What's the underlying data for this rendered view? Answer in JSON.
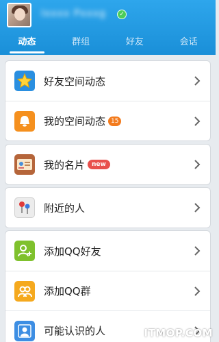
{
  "profile": {
    "nickname": "Ixxxx Pxxxg",
    "verified_icon": "check-circle-icon"
  },
  "tabs": [
    {
      "label": "动态",
      "active": true
    },
    {
      "label": "群组",
      "active": false
    },
    {
      "label": "好友",
      "active": false
    },
    {
      "label": "会话",
      "active": false
    }
  ],
  "menu": {
    "friends_feed": {
      "label": "好友空间动态",
      "icon": "qzone-star-icon",
      "color": "#2a8fe0"
    },
    "my_feed": {
      "label": "我的空间动态",
      "icon": "qq-bell-icon",
      "color": "#f5901e",
      "badge": "15"
    },
    "my_card": {
      "label": "我的名片",
      "icon": "business-card-icon",
      "color": "#b5653a",
      "badge": "new"
    },
    "nearby": {
      "label": "附近的人",
      "icon": "map-pin-icon",
      "color": "#e8e8e8"
    },
    "add_friend": {
      "label": "添加QQ好友",
      "icon": "add-user-icon",
      "color": "#7fc12d"
    },
    "add_group": {
      "label": "添加QQ群",
      "icon": "group-icon",
      "color": "#f5a91e"
    },
    "people_may_know": {
      "label": "可能认识的人",
      "icon": "contact-icon",
      "color": "#3d8ee3"
    }
  },
  "watermark": "ITMOP.COM"
}
